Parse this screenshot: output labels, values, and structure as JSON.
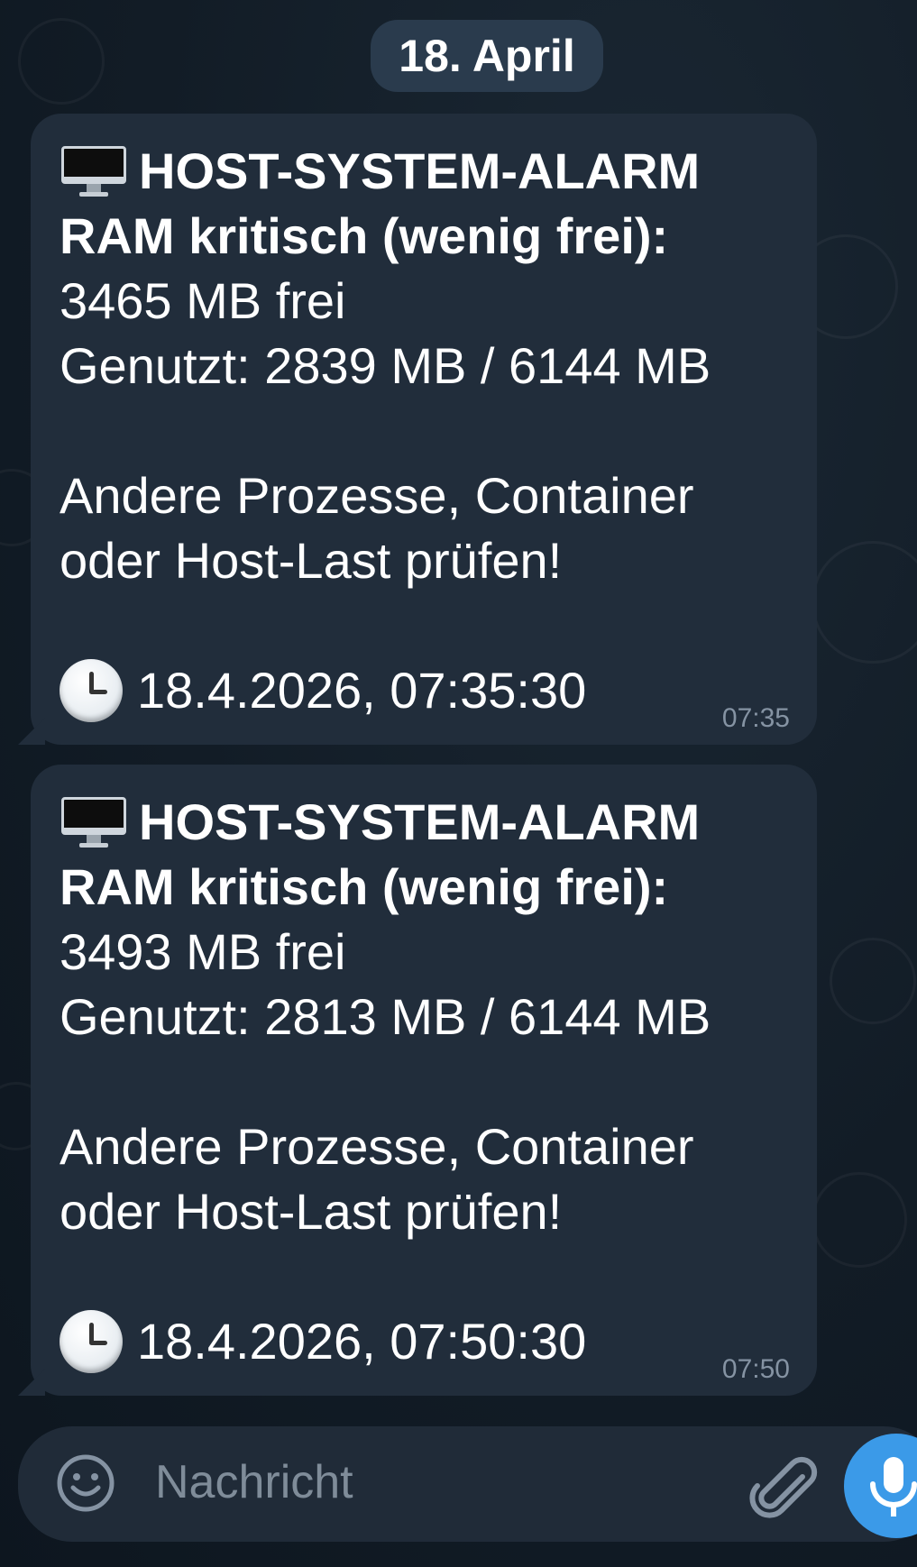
{
  "date_separator": "18. April",
  "messages": [
    {
      "title": "HOST-SYSTEM-ALARM",
      "subtitle": "RAM kritisch (wenig frei):",
      "free": "3465 MB frei",
      "used": "Genutzt: 2839 MB / 6144 MB",
      "advice_1": "Andere Prozesse, Container",
      "advice_2": "oder Host-Last prüfen!",
      "timestamp": "18.4.2026, 07:35:30",
      "time": "07:35",
      "icons": [
        "desktop-computer-icon",
        "clock-icon"
      ]
    },
    {
      "title": "HOST-SYSTEM-ALARM",
      "subtitle": "RAM kritisch (wenig frei):",
      "free": "3493 MB frei",
      "used": "Genutzt: 2813 MB / 6144 MB",
      "advice_1": "Andere Prozesse, Container",
      "advice_2": "oder Host-Last prüfen!",
      "timestamp": "18.4.2026, 07:50:30",
      "time": "07:50",
      "icons": [
        "desktop-computer-icon",
        "clock-icon"
      ]
    }
  ],
  "composer": {
    "placeholder": "Nachricht",
    "icons": [
      "emoji-icon",
      "attach-icon",
      "microphone-icon"
    ]
  },
  "colors": {
    "bubble": "#212d3b",
    "accent": "#3b9ae8",
    "background": "#0f1923"
  }
}
